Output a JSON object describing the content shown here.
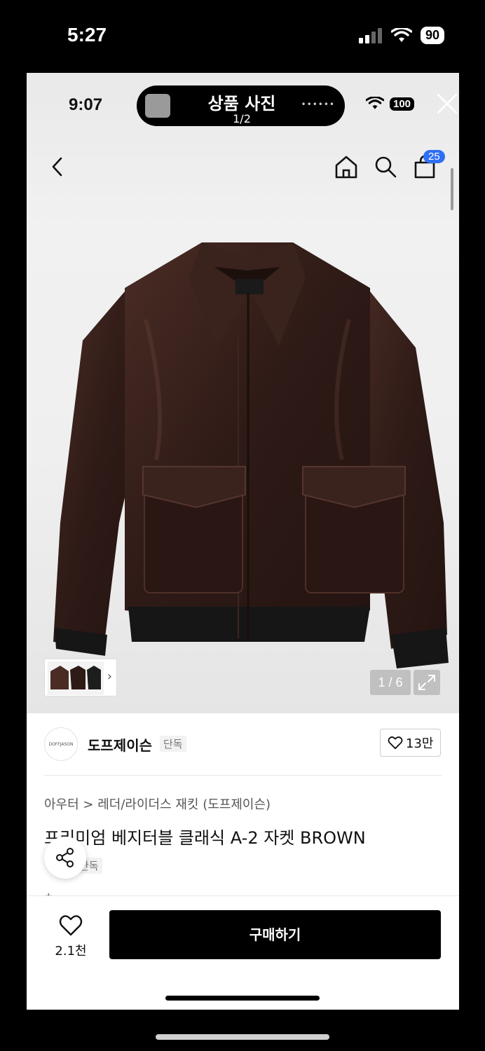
{
  "outer_status": {
    "time": "5:27",
    "battery": "90"
  },
  "inner_status": {
    "time": "9:07",
    "battery": "100"
  },
  "viewer": {
    "title": "상품 사진",
    "page": "1/2"
  },
  "nav": {
    "cart_count": "25"
  },
  "gallery": {
    "counter": "1 / 6",
    "thumbnail_chevron": "›"
  },
  "brand": {
    "logo_text": "DOFFJASON",
    "name": "도프제이슨",
    "tag": "단독",
    "likes": "13만"
  },
  "product": {
    "breadcrumb": "아우터 > 레더/라이더스 재킷 (도프제이슨)",
    "title": "프리미엄 베지터블 클래식 A-2 자켓 BROWN",
    "tag": "단독"
  },
  "bottom_bar": {
    "wishlist_count": "2.1천",
    "buy_label": "구매하기"
  },
  "colors": {
    "accent": "#2f6ff5",
    "buy_button": "#000000",
    "jacket": "#2e1a16"
  }
}
